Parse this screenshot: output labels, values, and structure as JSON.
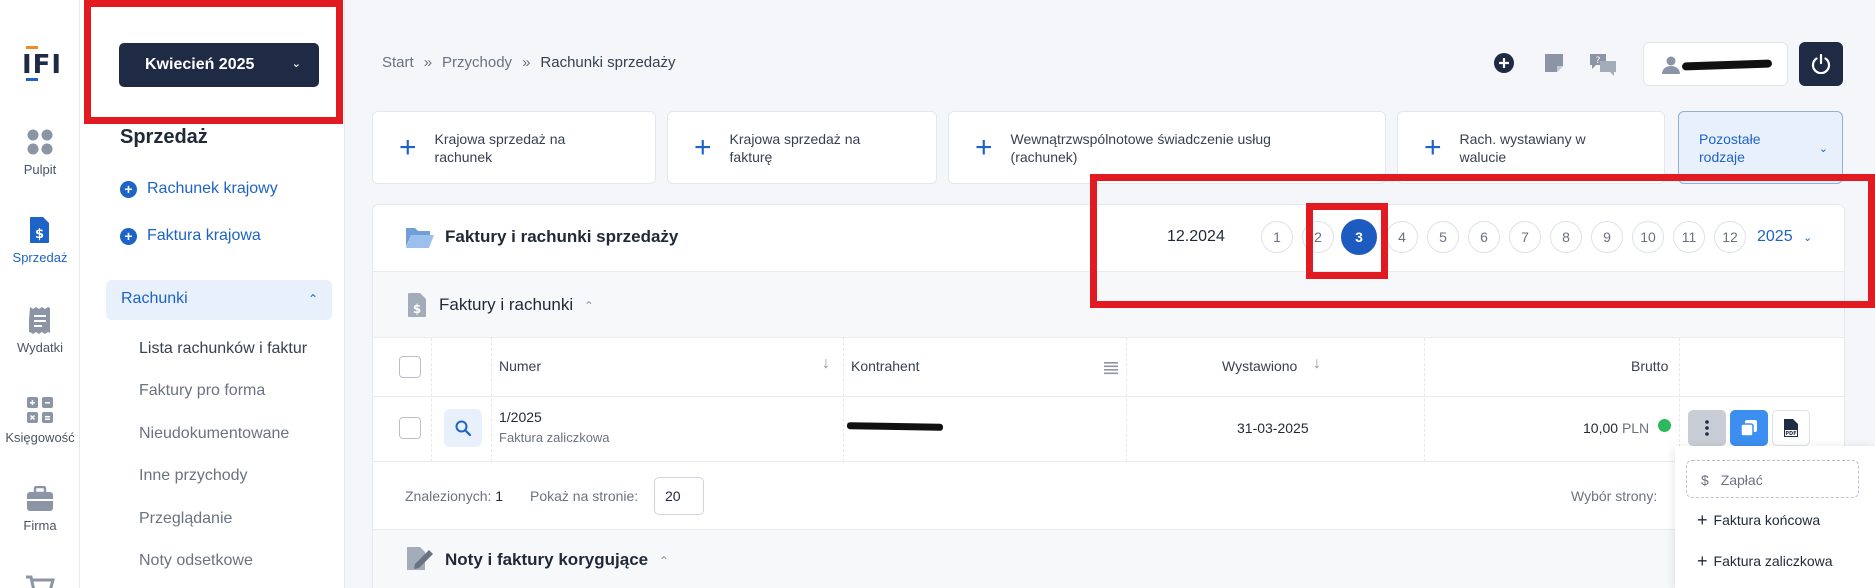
{
  "logo": {
    "text": "IFI"
  },
  "rail": [
    {
      "id": "pulpit",
      "label": "Pulpit"
    },
    {
      "id": "sprzedaz",
      "label": "Sprzedaż"
    },
    {
      "id": "wydatki",
      "label": "Wydatki"
    },
    {
      "id": "ksiegowosc",
      "label": "Księgowość"
    },
    {
      "id": "firma",
      "label": "Firma"
    }
  ],
  "sidebar": {
    "month_label": "Kwiecień 2025",
    "section_title": "Sprzedaż",
    "links": [
      "Rachunek krajowy",
      "Faktura krajowa"
    ],
    "group_label": "Rachunki",
    "sub_items": [
      "Lista rachunków i faktur",
      "Faktury pro forma",
      "Nieudokumentowane",
      "Inne przychody",
      "Przeglądanie",
      "Noty odsetkowe"
    ]
  },
  "breadcrumb": [
    "Start",
    "Przychody",
    "Rachunki sprzedaży"
  ],
  "quick_add": [
    "Krajowa sprzedaż na rachunek",
    "Krajowa sprzedaż na fakturę",
    "Wewnątrzwspólnotowe  świadczenie usług (rachunek)",
    "Rach. wystawiany w walucie"
  ],
  "quick_other": "Pozostałe rodzaje",
  "panel": {
    "title": "Faktury i rachunki sprzedaży",
    "period": "12.2024",
    "months": [
      "1",
      "2",
      "3",
      "4",
      "5",
      "6",
      "7",
      "8",
      "9",
      "10",
      "11",
      "12"
    ],
    "active_month": "3",
    "year": "2025"
  },
  "list": {
    "title": "Faktury i rachunki",
    "columns": {
      "numer": "Numer",
      "kontrahent": "Kontrahent",
      "wystawiono": "Wystawiono",
      "brutto": "Brutto"
    },
    "rows": [
      {
        "numer": "1/2025",
        "typ": "Faktura zaliczkowa",
        "wystawiono": "31-03-2025",
        "brutto": "10,00",
        "waluta": "PLN"
      }
    ],
    "found_label": "Znalezionych:",
    "found_count": "1",
    "per_page_label": "Pokaż na stronie:",
    "per_page_value": "20",
    "page_select_label": "Wybór strony:"
  },
  "notes": {
    "title": "Noty i faktury korygujące"
  },
  "menu": {
    "pay": "Zapłać",
    "items": [
      "Faktura końcowa",
      "Faktura zaliczkowa"
    ]
  },
  "colors": {
    "accent": "#1e63c6",
    "dark": "#1f2a44",
    "highlight": "#e21b23",
    "status_paid": "#2eb85c"
  }
}
